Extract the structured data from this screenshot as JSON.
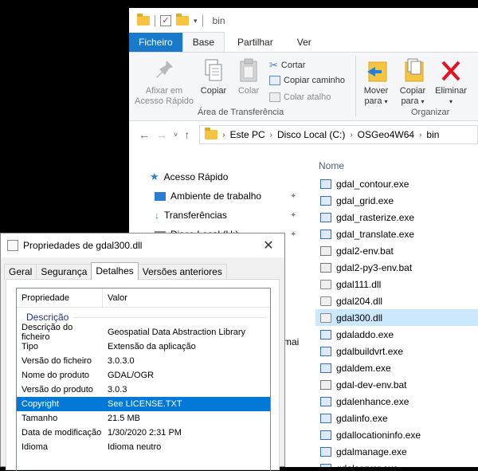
{
  "explorer": {
    "title": "bin",
    "ribbon_tabs": [
      "Ficheiro",
      "Base",
      "Partilhar",
      "Ver"
    ],
    "clipboard": {
      "pin_label_1": "Afixar em",
      "pin_label_2": "Acesso Rápido",
      "copy": "Copiar",
      "paste": "Colar",
      "cut": "Cortar",
      "copy_path": "Copiar caminho",
      "paste_shortcut": "Colar atalho",
      "group_label": "Área de Transferência"
    },
    "organize": {
      "move_1": "Mover",
      "move_2": "para",
      "copy_1": "Copiar",
      "copy_2": "para",
      "delete": "Eliminar",
      "group_label": "Organizar"
    },
    "address": [
      "Este PC",
      "Disco Local (C:)",
      "OSGeo4W64",
      "bin"
    ],
    "nav_items": [
      {
        "label": "Acesso Rápido"
      },
      {
        "label": "Ambiente de trabalho"
      },
      {
        "label": "Transferências"
      },
      {
        "label": "Disco Local (H:)"
      }
    ],
    "nav_partial": "mai",
    "column_name": "Nome",
    "files": [
      {
        "name": "gdal_contour.exe",
        "type": "exe"
      },
      {
        "name": "gdal_grid.exe",
        "type": "exe"
      },
      {
        "name": "gdal_rasterize.exe",
        "type": "exe"
      },
      {
        "name": "gdal_translate.exe",
        "type": "exe"
      },
      {
        "name": "gdal2-env.bat",
        "type": "bat"
      },
      {
        "name": "gdal2-py3-env.bat",
        "type": "bat"
      },
      {
        "name": "gdal111.dll",
        "type": "dll"
      },
      {
        "name": "gdal204.dll",
        "type": "dll"
      },
      {
        "name": "gdal300.dll",
        "type": "dll",
        "selected": true
      },
      {
        "name": "gdaladdo.exe",
        "type": "exe"
      },
      {
        "name": "gdalbuildvrt.exe",
        "type": "exe"
      },
      {
        "name": "gdaldem.exe",
        "type": "exe"
      },
      {
        "name": "gdal-dev-env.bat",
        "type": "bat"
      },
      {
        "name": "gdalenhance.exe",
        "type": "exe"
      },
      {
        "name": "gdalinfo.exe",
        "type": "exe"
      },
      {
        "name": "gdallocationinfo.exe",
        "type": "exe"
      },
      {
        "name": "gdalmanage.exe",
        "type": "exe"
      },
      {
        "name": "gdalserver.exe",
        "type": "exe"
      }
    ]
  },
  "dialog": {
    "title": "Propriedades de gdal300.dll",
    "tabs": [
      "Geral",
      "Segurança",
      "Detalhes",
      "Versões anteriores"
    ],
    "active_tab": "Detalhes",
    "col_property": "Propriedade",
    "col_value": "Valor",
    "group": "Descrição",
    "rows": [
      {
        "k": "Descrição do ficheiro",
        "v": "Geospatial Data Abstraction Library"
      },
      {
        "k": "Tipo",
        "v": "Extensão da aplicação"
      },
      {
        "k": "Versão do ficheiro",
        "v": "3.0.3.0"
      },
      {
        "k": "Nome do produto",
        "v": "GDAL/OGR"
      },
      {
        "k": "Versão do produto",
        "v": "3.0.3"
      },
      {
        "k": "Copyright",
        "v": "See LICENSE.TXT",
        "selected": true
      },
      {
        "k": "Tamanho",
        "v": "21.5 MB"
      },
      {
        "k": "Data de modificação",
        "v": "1/30/2020 2:31 PM"
      },
      {
        "k": "Idioma",
        "v": "Idioma neutro"
      }
    ]
  },
  "colors": {
    "file_tab": "#1979ca",
    "selection_list": "#cce8ff",
    "selection_dialog": "#0078d7",
    "delete_icon": "#e81123"
  }
}
